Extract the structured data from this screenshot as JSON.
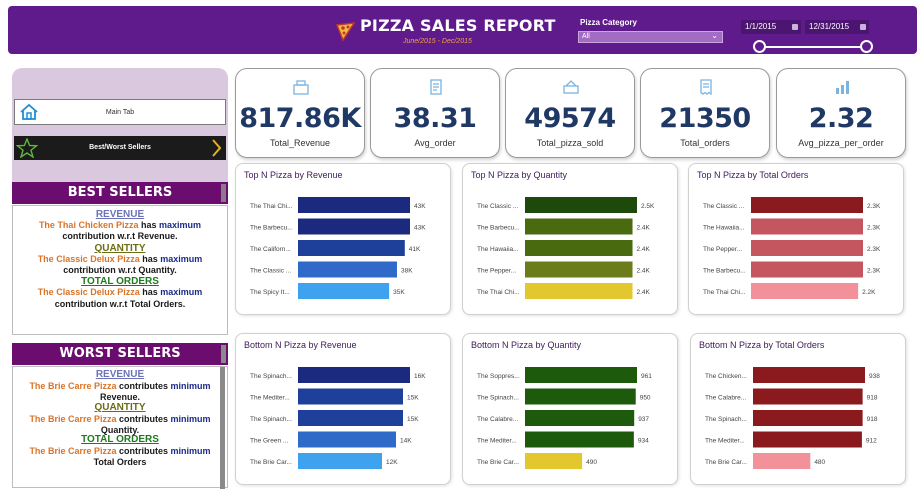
{
  "header": {
    "title": "PIZZA SALES REPORT",
    "subtitle": "June/2015  -  Dec/2015",
    "category_label": "Pizza Category",
    "category_value": "All",
    "date_start": "1/1/2015",
    "date_end": "12/31/2015",
    "slider": {
      "start": 0,
      "end": 1
    }
  },
  "nav": {
    "main_tab": "Main Tab",
    "best_worst": "Best/Worst Sellers"
  },
  "best": {
    "title": "BEST SELLERS",
    "revenue_h": "REVENUE",
    "revenue_pizza": "The Thai Chicken Pizza",
    "has": "has",
    "maximum": "maximum",
    "revenue_tail": "contribution w.r.t Revenue.",
    "qty_h": "QUANTITY",
    "qty_pizza": "The Classic Delux Pizza",
    "qty_tail": "contribution w.r.t Quantity.",
    "orders_h": "TOTAL ORDERS",
    "orders_pizza": "The Classic Delux Pizza",
    "orders_tail": "contribution w.r.t Total Orders."
  },
  "worst": {
    "title": "WORST SELLERS",
    "revenue_h": "REVENUE",
    "pizza": "The Brie Carre Pizza",
    "contributes": "contributes",
    "minimum": "minimum",
    "revenue_tail": "Revenue.",
    "qty_h": "QUANTITY",
    "qty_tail": "Quantity.",
    "orders_h": "TOTAL ORDERS",
    "orders_tail": "Total Orders"
  },
  "kpis": [
    {
      "value": "817.86K",
      "label": "Total_Revenue",
      "icon": "cash-register-icon"
    },
    {
      "value": "38.31",
      "label": "Avg_order",
      "icon": "clipboard-icon"
    },
    {
      "value": "49574",
      "label": "Total_pizza_sold",
      "icon": "pizza-box-icon"
    },
    {
      "value": "21350",
      "label": "Total_orders",
      "icon": "receipt-icon"
    },
    {
      "value": "2.32",
      "label": "Avg_pizza_per_order",
      "icon": "bar-chart-icon"
    }
  ],
  "chart_data": [
    {
      "type": "bar",
      "title": "Top N Pizza by Revenue",
      "categories": [
        "The Thai Chi...",
        "The Barbecu...",
        "The Californ...",
        "The Classic ...",
        "The Spicy It..."
      ],
      "values": [
        43,
        43,
        41,
        38,
        35
      ],
      "labels": [
        "43K",
        "43K",
        "41K",
        "38K",
        "35K"
      ],
      "colors": [
        "#1b2a7e",
        "#1b2a7e",
        "#1e3f9a",
        "#2f6ac8",
        "#3fa2ef"
      ]
    },
    {
      "type": "bar",
      "title": "Top N Pizza by Quantity",
      "categories": [
        "The Classic ...",
        "The Barbecu...",
        "The Hawaiia...",
        "The Pepper...",
        "The Thai Chi..."
      ],
      "values": [
        2.5,
        2.4,
        2.4,
        2.4,
        2.4
      ],
      "labels": [
        "2.5K",
        "2.4K",
        "2.4K",
        "2.4K",
        "2.4K"
      ],
      "colors": [
        "#1d4a0b",
        "#4a6a10",
        "#4a6a10",
        "#6a7d1a",
        "#e2c72e"
      ]
    },
    {
      "type": "bar",
      "title": "Top N Pizza by Total Orders",
      "categories": [
        "The Classic ...",
        "The Hawaiia...",
        "The Pepper...",
        "The Barbecu...",
        "The Thai Chi..."
      ],
      "values": [
        2.3,
        2.3,
        2.3,
        2.3,
        2.2
      ],
      "labels": [
        "2.3K",
        "2.3K",
        "2.3K",
        "2.3K",
        "2.2K"
      ],
      "colors": [
        "#8b1a1f",
        "#c4565f",
        "#c4565f",
        "#c4565f",
        "#f2919a"
      ]
    },
    {
      "type": "bar",
      "title": "Bottom N Pizza by Revenue",
      "categories": [
        "The Spinach...",
        "The Mediter...",
        "The Spinach...",
        "The Green ...",
        "The Brie Car..."
      ],
      "values": [
        16,
        15,
        15,
        14,
        12
      ],
      "labels": [
        "16K",
        "15K",
        "15K",
        "14K",
        "12K"
      ],
      "colors": [
        "#1b2a7e",
        "#1e3f9a",
        "#1e3f9a",
        "#2f6ac8",
        "#3fa2ef"
      ]
    },
    {
      "type": "bar",
      "title": "Bottom N Pizza by Quantity",
      "categories": [
        "The Soppres...",
        "The Spinach...",
        "The Calabre...",
        "The Mediter...",
        "The Brie Car..."
      ],
      "values": [
        961,
        950,
        937,
        934,
        490
      ],
      "labels": [
        "961",
        "950",
        "937",
        "934",
        "490"
      ],
      "colors": [
        "#1d5a0b",
        "#1d5a0b",
        "#1d5a0b",
        "#1d5a0b",
        "#e2c72e"
      ]
    },
    {
      "type": "bar",
      "title": "Bottom N Pizza by Total Orders",
      "categories": [
        "The Chicken...",
        "The Calabre...",
        "The Spinach...",
        "The Mediter...",
        "The Brie Car..."
      ],
      "values": [
        938,
        918,
        918,
        912,
        480
      ],
      "labels": [
        "938",
        "918",
        "918",
        "912",
        "480"
      ],
      "colors": [
        "#8b1a1f",
        "#8b1a1f",
        "#8b1a1f",
        "#8b1a1f",
        "#f2919a"
      ]
    }
  ]
}
